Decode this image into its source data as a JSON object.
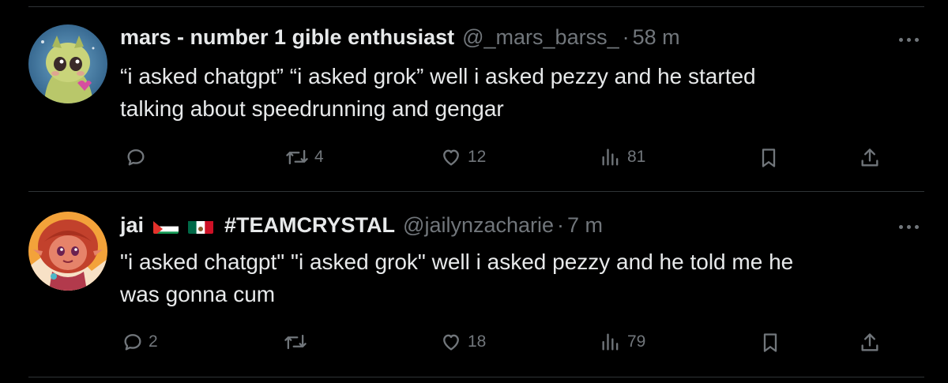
{
  "tweets": [
    {
      "author_name": "mars - number 1 gible enthusiast",
      "handle": "@_mars_barss_",
      "time": "58 m",
      "text_line1": "“i asked chatgpt” “i asked grok” well i asked pezzy and he started",
      "text_line2": "talking about speedrunning and gengar",
      "reply_count": "",
      "retweet_count": "4",
      "like_count": "12",
      "view_count": "81"
    },
    {
      "author_name": "jai",
      "flags": [
        "palestine-flag",
        "mexico-flag"
      ],
      "author_tag": "#TEAMCRYSTAL",
      "handle": "@jailynzacharie",
      "time": "7 m",
      "text_line1": "\"i asked chatgpt\" \"i asked grok\" well i asked pezzy and he told me he",
      "text_line2": "was gonna cum",
      "reply_count": "2",
      "retweet_count": "",
      "like_count": "18",
      "view_count": "79"
    }
  ],
  "separator": "·",
  "colors": {
    "background": "#000000",
    "text": "#e7e9ea",
    "secondary": "#71767b",
    "divider": "#2f3336"
  },
  "icons": [
    "reply-icon",
    "retweet-icon",
    "like-icon",
    "views-icon",
    "bookmark-icon",
    "share-icon",
    "more-icon"
  ]
}
